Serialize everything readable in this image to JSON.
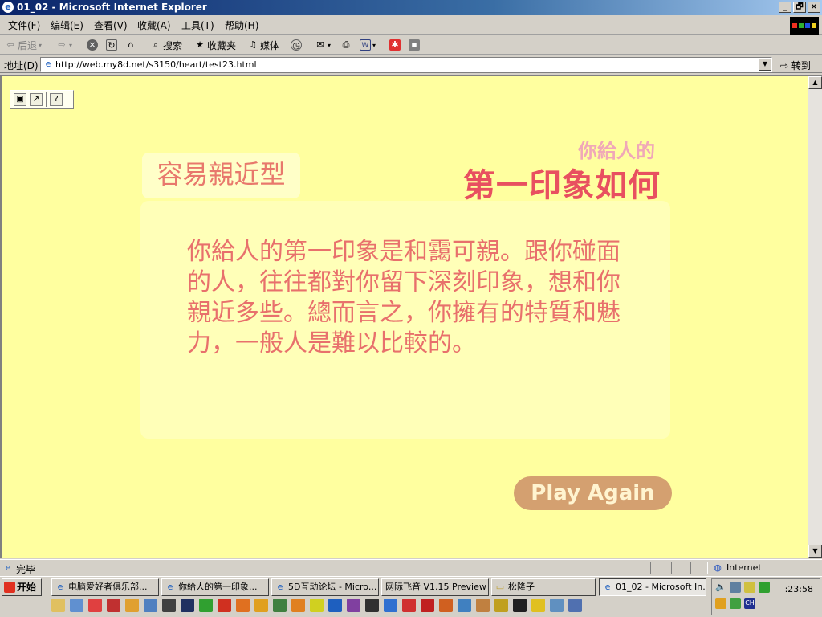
{
  "window": {
    "title": "01_02 - Microsoft Internet Explorer",
    "buttons": [
      "_",
      "🗗",
      "×"
    ]
  },
  "menubar": {
    "items": [
      "文件(F)",
      "编辑(E)",
      "查看(V)",
      "收藏(A)",
      "工具(T)",
      "帮助(H)"
    ]
  },
  "toolbar": {
    "back": "后退",
    "search": "搜索",
    "favorites": "收藏夹",
    "media": "媒体"
  },
  "address": {
    "label": "地址(D)",
    "url": "http://web.my8d.net/s3150/heart/test23.html",
    "go": "转到"
  },
  "page": {
    "type_tag": "容易親近型",
    "heading_sub": "你給人的",
    "heading_main": "第一印象如何",
    "result": "你給人的第一印象是和靄可親。跟你碰面的人，往往都對你留下深刻印象，想和你親近多些。總而言之，你擁有的特質和魅力，一般人是難以比較的。",
    "play_again": "Play Again",
    "colors": {
      "background": "#ffff9f",
      "accent": "#e85060",
      "button": "#d4a070"
    }
  },
  "status": {
    "text": "完毕",
    "zone": "Internet"
  },
  "taskbar": {
    "start": "开始",
    "tasks": [
      "电脑爱好者俱乐部...",
      "你給人的第一印象...",
      "5D互动论坛 - Micro...",
      "网际飞音 V1.15 Preview",
      "松隆子",
      "01_02 - Microsoft In..."
    ],
    "clock": ":23:58",
    "tray_lang": "CH"
  }
}
